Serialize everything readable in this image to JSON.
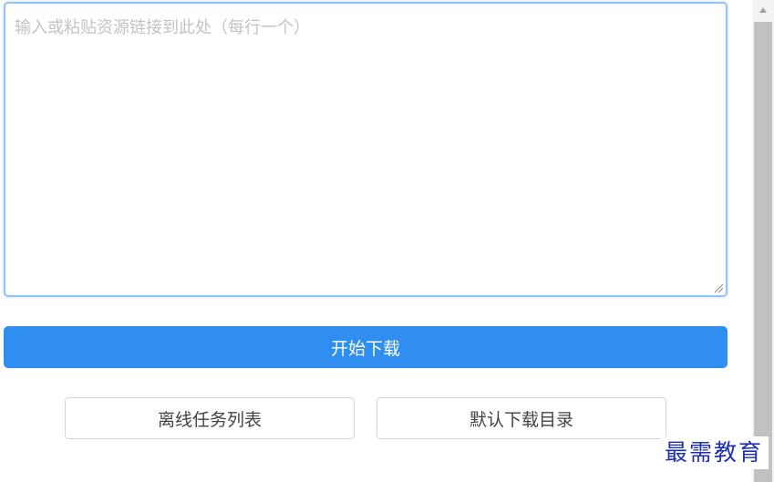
{
  "links_input": {
    "placeholder": "输入或粘贴资源链接到此处（每行一个）",
    "value": ""
  },
  "actions": {
    "start_download_label": "开始下载",
    "offline_tasks_label": "离线任务列表",
    "default_dir_label": "默认下载目录"
  },
  "watermark": {
    "text": "最需教育"
  },
  "colors": {
    "primary": "#2f8ef0",
    "focus_border": "#8fc4f8",
    "watermark": "#1f2fb4"
  }
}
